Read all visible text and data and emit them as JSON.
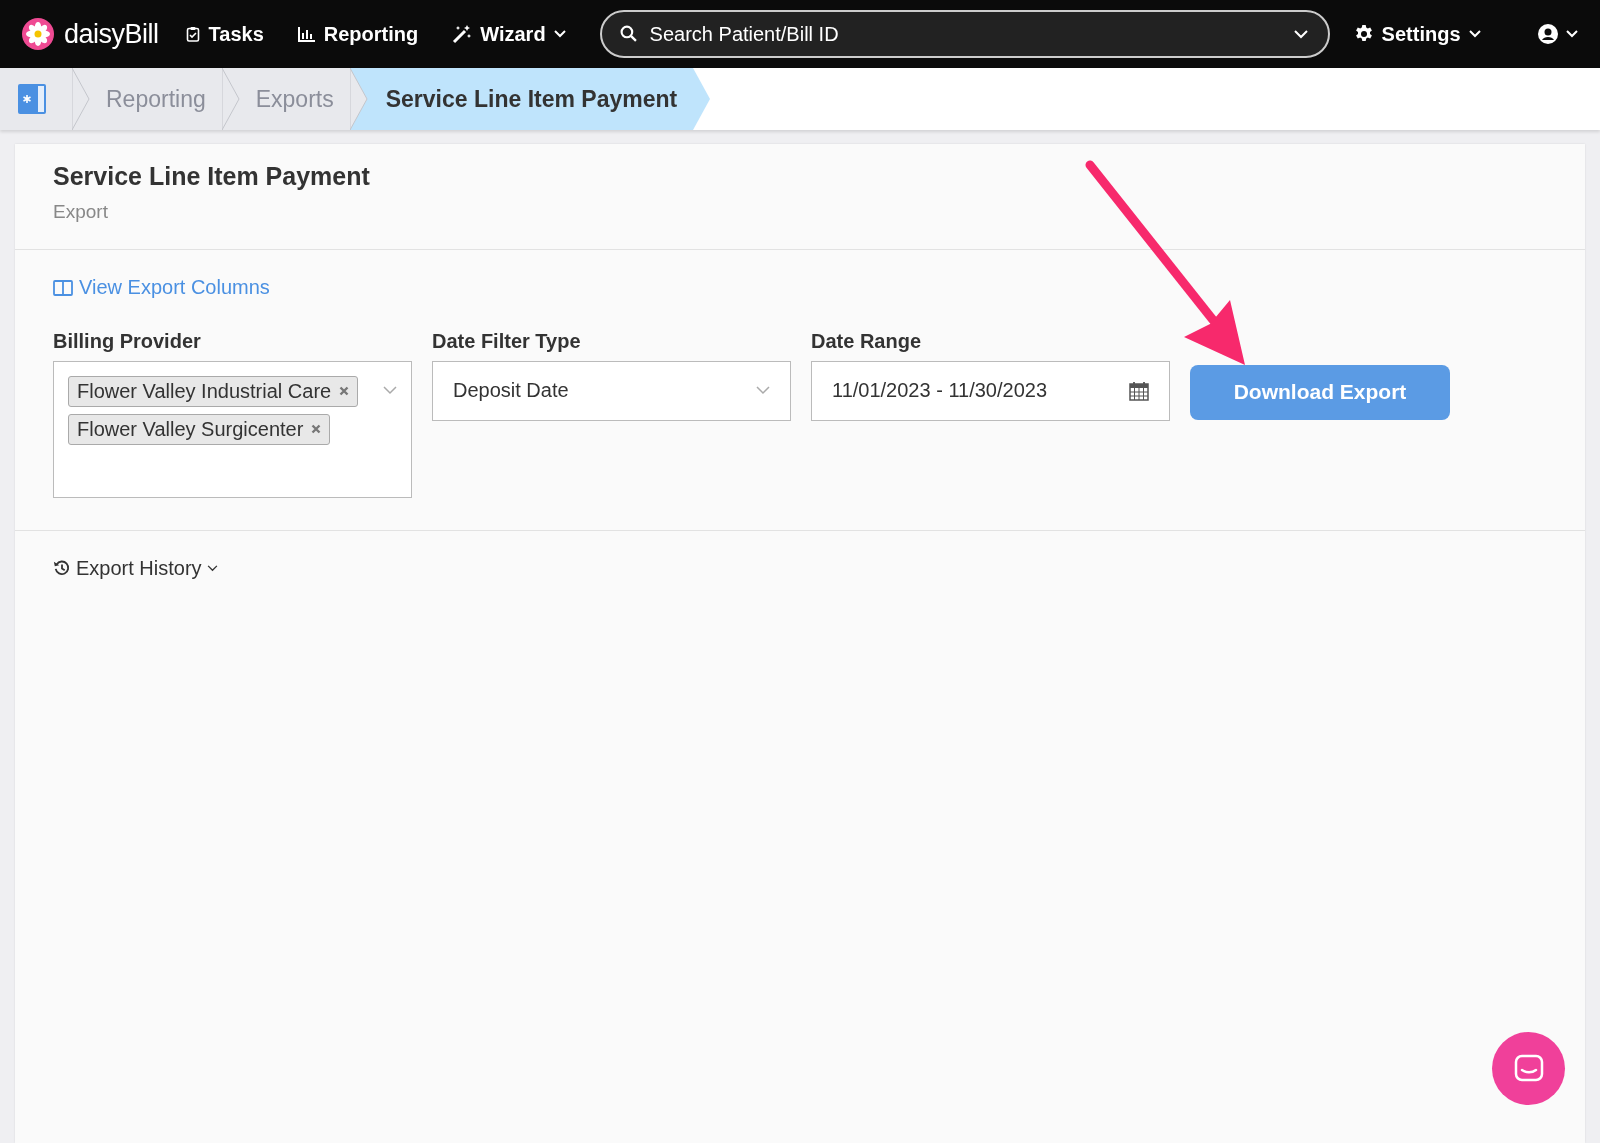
{
  "topbar": {
    "brand": "daisyBill",
    "nav": [
      {
        "label": "Tasks",
        "kind": "tasks",
        "dropdown": false
      },
      {
        "label": "Reporting",
        "kind": "reporting",
        "dropdown": false
      },
      {
        "label": "Wizard",
        "kind": "wizard",
        "dropdown": true
      }
    ],
    "search": {
      "placeholder": "Search Patient/Bill ID"
    },
    "settings": "Settings"
  },
  "breadcrumb": [
    {
      "label": "Reporting",
      "selected": false
    },
    {
      "label": "Exports",
      "selected": false
    },
    {
      "label": "Service Line Item Payment",
      "selected": true
    }
  ],
  "page": {
    "title": "Service Line Item Payment",
    "subtitle": "Export"
  },
  "link": "View Export Columns",
  "filters": [
    {
      "label": "Billing Provider",
      "kind": "multi",
      "tags": [
        "Flower Valley Industrial Care",
        "Flower Valley Surgicenter"
      ]
    },
    {
      "label": "Date Filter Type",
      "kind": "select",
      "value": "Deposit Date"
    },
    {
      "label": "Date Range",
      "kind": "date",
      "value": "11/01/2023 - 11/30/2023"
    }
  ],
  "download_button": "Download Export",
  "history": "Export History"
}
